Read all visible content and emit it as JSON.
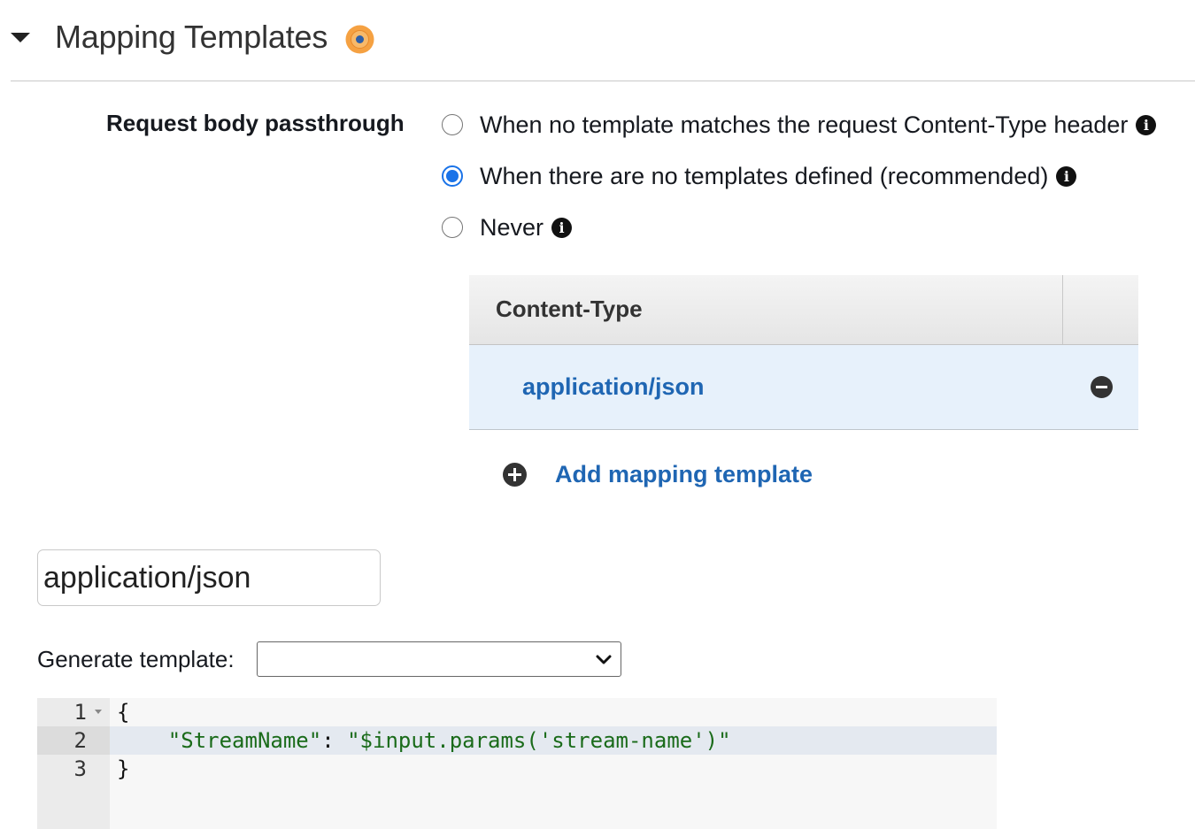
{
  "section": {
    "title": "Mapping Templates",
    "status_icon": "unsaved-changes-dot",
    "status_color": "#f5a142"
  },
  "passthrough": {
    "label": "Request body passthrough",
    "options": [
      {
        "label": "When no template matches the request Content-Type header",
        "selected": false
      },
      {
        "label": "When there are no templates defined (recommended)",
        "selected": true
      },
      {
        "label": "Never",
        "selected": false
      }
    ]
  },
  "content_type_table": {
    "header": "Content-Type",
    "rows": [
      "application/json"
    ],
    "add_label": "Add mapping template"
  },
  "template_editor": {
    "content_type_value": "application/json",
    "generate_label": "Generate template:",
    "generate_selected": "",
    "lines": [
      {
        "number": "1",
        "code": "{"
      },
      {
        "number": "2",
        "code_indent": "    ",
        "code_key": "\"StreamName\"",
        "code_sep": ": ",
        "code_value": "\"$input.params('stream-name')\""
      },
      {
        "number": "3",
        "code": "}"
      }
    ]
  },
  "colors": {
    "link": "#1f66b3",
    "radio_selected": "#1a73e8",
    "selected_row_bg": "#e7f1fb"
  }
}
